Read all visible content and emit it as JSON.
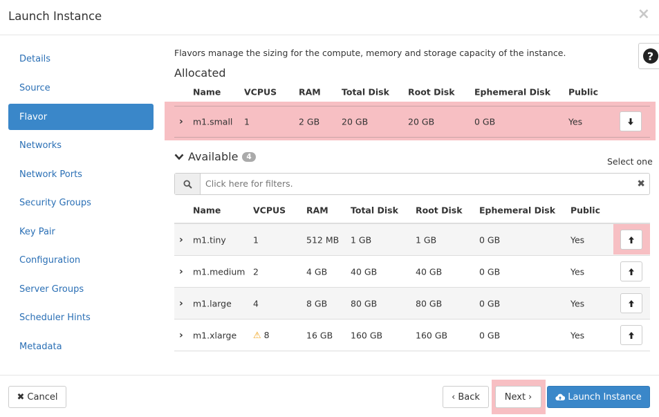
{
  "modal": {
    "title": "Launch Instance"
  },
  "nav": {
    "items": [
      {
        "label": "Details"
      },
      {
        "label": "Source"
      },
      {
        "label": "Flavor"
      },
      {
        "label": "Networks"
      },
      {
        "label": "Network Ports"
      },
      {
        "label": "Security Groups"
      },
      {
        "label": "Key Pair"
      },
      {
        "label": "Configuration"
      },
      {
        "label": "Server Groups"
      },
      {
        "label": "Scheduler Hints"
      },
      {
        "label": "Metadata"
      }
    ],
    "active": "Flavor"
  },
  "flavor": {
    "intro": "Flavors manage the sizing for the compute, memory and storage capacity of the instance.",
    "allocated_title": "Allocated",
    "available_title": "Available",
    "available_count": "4",
    "select_hint": "Select one",
    "columns": [
      "Name",
      "VCPUS",
      "RAM",
      "Total Disk",
      "Root Disk",
      "Ephemeral Disk",
      "Public"
    ],
    "allocated": [
      {
        "name": "m1.small",
        "vcpus": "1",
        "ram": "2 GB",
        "total_disk": "20 GB",
        "root_disk": "20 GB",
        "ephemeral": "0 GB",
        "public": "Yes"
      }
    ],
    "available": [
      {
        "name": "m1.tiny",
        "vcpus": "1",
        "ram": "512 MB",
        "total_disk": "1 GB",
        "root_disk": "1 GB",
        "ephemeral": "0 GB",
        "public": "Yes"
      },
      {
        "name": "m1.medium",
        "vcpus": "2",
        "ram": "4 GB",
        "total_disk": "40 GB",
        "root_disk": "40 GB",
        "ephemeral": "0 GB",
        "public": "Yes"
      },
      {
        "name": "m1.large",
        "vcpus": "4",
        "ram": "8 GB",
        "total_disk": "80 GB",
        "root_disk": "80 GB",
        "ephemeral": "0 GB",
        "public": "Yes"
      },
      {
        "name": "m1.xlarge",
        "vcpus": "8",
        "ram": "16 GB",
        "total_disk": "160 GB",
        "root_disk": "160 GB",
        "ephemeral": "0 GB",
        "public": "Yes"
      }
    ],
    "filter": {
      "placeholder": "Click here for filters."
    }
  },
  "footer": {
    "cancel": "Cancel",
    "back": "Back",
    "next": "Next",
    "launch": "Launch Instance"
  },
  "colors": {
    "primary": "#3a87c9",
    "highlight": "#f7bfc3",
    "link": "#2a6fb5",
    "warning": "#f0a31b"
  }
}
